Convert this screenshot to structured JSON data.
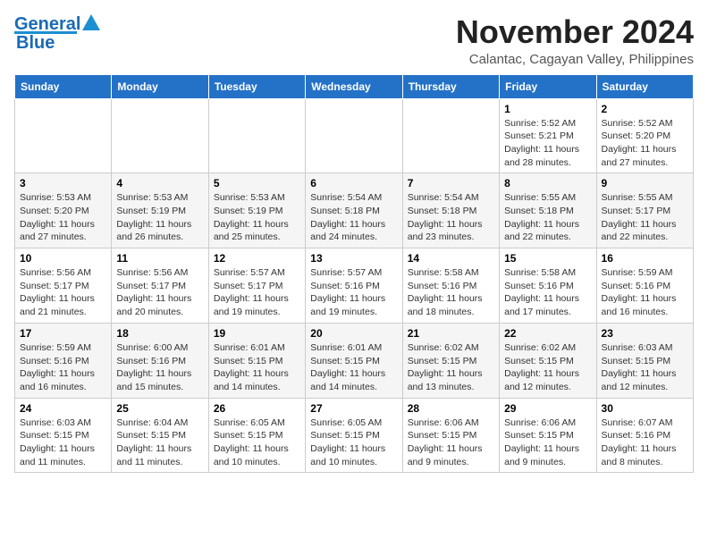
{
  "logo": {
    "part1": "General",
    "part2": "Blue"
  },
  "header": {
    "month": "November 2024",
    "location": "Calantac, Cagayan Valley, Philippines"
  },
  "weekdays": [
    "Sunday",
    "Monday",
    "Tuesday",
    "Wednesday",
    "Thursday",
    "Friday",
    "Saturday"
  ],
  "weeks": [
    [
      {
        "day": "",
        "info": ""
      },
      {
        "day": "",
        "info": ""
      },
      {
        "day": "",
        "info": ""
      },
      {
        "day": "",
        "info": ""
      },
      {
        "day": "",
        "info": ""
      },
      {
        "day": "1",
        "info": "Sunrise: 5:52 AM\nSunset: 5:21 PM\nDaylight: 11 hours and 28 minutes."
      },
      {
        "day": "2",
        "info": "Sunrise: 5:52 AM\nSunset: 5:20 PM\nDaylight: 11 hours and 27 minutes."
      }
    ],
    [
      {
        "day": "3",
        "info": "Sunrise: 5:53 AM\nSunset: 5:20 PM\nDaylight: 11 hours and 27 minutes."
      },
      {
        "day": "4",
        "info": "Sunrise: 5:53 AM\nSunset: 5:19 PM\nDaylight: 11 hours and 26 minutes."
      },
      {
        "day": "5",
        "info": "Sunrise: 5:53 AM\nSunset: 5:19 PM\nDaylight: 11 hours and 25 minutes."
      },
      {
        "day": "6",
        "info": "Sunrise: 5:54 AM\nSunset: 5:18 PM\nDaylight: 11 hours and 24 minutes."
      },
      {
        "day": "7",
        "info": "Sunrise: 5:54 AM\nSunset: 5:18 PM\nDaylight: 11 hours and 23 minutes."
      },
      {
        "day": "8",
        "info": "Sunrise: 5:55 AM\nSunset: 5:18 PM\nDaylight: 11 hours and 22 minutes."
      },
      {
        "day": "9",
        "info": "Sunrise: 5:55 AM\nSunset: 5:17 PM\nDaylight: 11 hours and 22 minutes."
      }
    ],
    [
      {
        "day": "10",
        "info": "Sunrise: 5:56 AM\nSunset: 5:17 PM\nDaylight: 11 hours and 21 minutes."
      },
      {
        "day": "11",
        "info": "Sunrise: 5:56 AM\nSunset: 5:17 PM\nDaylight: 11 hours and 20 minutes."
      },
      {
        "day": "12",
        "info": "Sunrise: 5:57 AM\nSunset: 5:17 PM\nDaylight: 11 hours and 19 minutes."
      },
      {
        "day": "13",
        "info": "Sunrise: 5:57 AM\nSunset: 5:16 PM\nDaylight: 11 hours and 19 minutes."
      },
      {
        "day": "14",
        "info": "Sunrise: 5:58 AM\nSunset: 5:16 PM\nDaylight: 11 hours and 18 minutes."
      },
      {
        "day": "15",
        "info": "Sunrise: 5:58 AM\nSunset: 5:16 PM\nDaylight: 11 hours and 17 minutes."
      },
      {
        "day": "16",
        "info": "Sunrise: 5:59 AM\nSunset: 5:16 PM\nDaylight: 11 hours and 16 minutes."
      }
    ],
    [
      {
        "day": "17",
        "info": "Sunrise: 5:59 AM\nSunset: 5:16 PM\nDaylight: 11 hours and 16 minutes."
      },
      {
        "day": "18",
        "info": "Sunrise: 6:00 AM\nSunset: 5:16 PM\nDaylight: 11 hours and 15 minutes."
      },
      {
        "day": "19",
        "info": "Sunrise: 6:01 AM\nSunset: 5:15 PM\nDaylight: 11 hours and 14 minutes."
      },
      {
        "day": "20",
        "info": "Sunrise: 6:01 AM\nSunset: 5:15 PM\nDaylight: 11 hours and 14 minutes."
      },
      {
        "day": "21",
        "info": "Sunrise: 6:02 AM\nSunset: 5:15 PM\nDaylight: 11 hours and 13 minutes."
      },
      {
        "day": "22",
        "info": "Sunrise: 6:02 AM\nSunset: 5:15 PM\nDaylight: 11 hours and 12 minutes."
      },
      {
        "day": "23",
        "info": "Sunrise: 6:03 AM\nSunset: 5:15 PM\nDaylight: 11 hours and 12 minutes."
      }
    ],
    [
      {
        "day": "24",
        "info": "Sunrise: 6:03 AM\nSunset: 5:15 PM\nDaylight: 11 hours and 11 minutes."
      },
      {
        "day": "25",
        "info": "Sunrise: 6:04 AM\nSunset: 5:15 PM\nDaylight: 11 hours and 11 minutes."
      },
      {
        "day": "26",
        "info": "Sunrise: 6:05 AM\nSunset: 5:15 PM\nDaylight: 11 hours and 10 minutes."
      },
      {
        "day": "27",
        "info": "Sunrise: 6:05 AM\nSunset: 5:15 PM\nDaylight: 11 hours and 10 minutes."
      },
      {
        "day": "28",
        "info": "Sunrise: 6:06 AM\nSunset: 5:15 PM\nDaylight: 11 hours and 9 minutes."
      },
      {
        "day": "29",
        "info": "Sunrise: 6:06 AM\nSunset: 5:15 PM\nDaylight: 11 hours and 9 minutes."
      },
      {
        "day": "30",
        "info": "Sunrise: 6:07 AM\nSunset: 5:16 PM\nDaylight: 11 hours and 8 minutes."
      }
    ]
  ]
}
